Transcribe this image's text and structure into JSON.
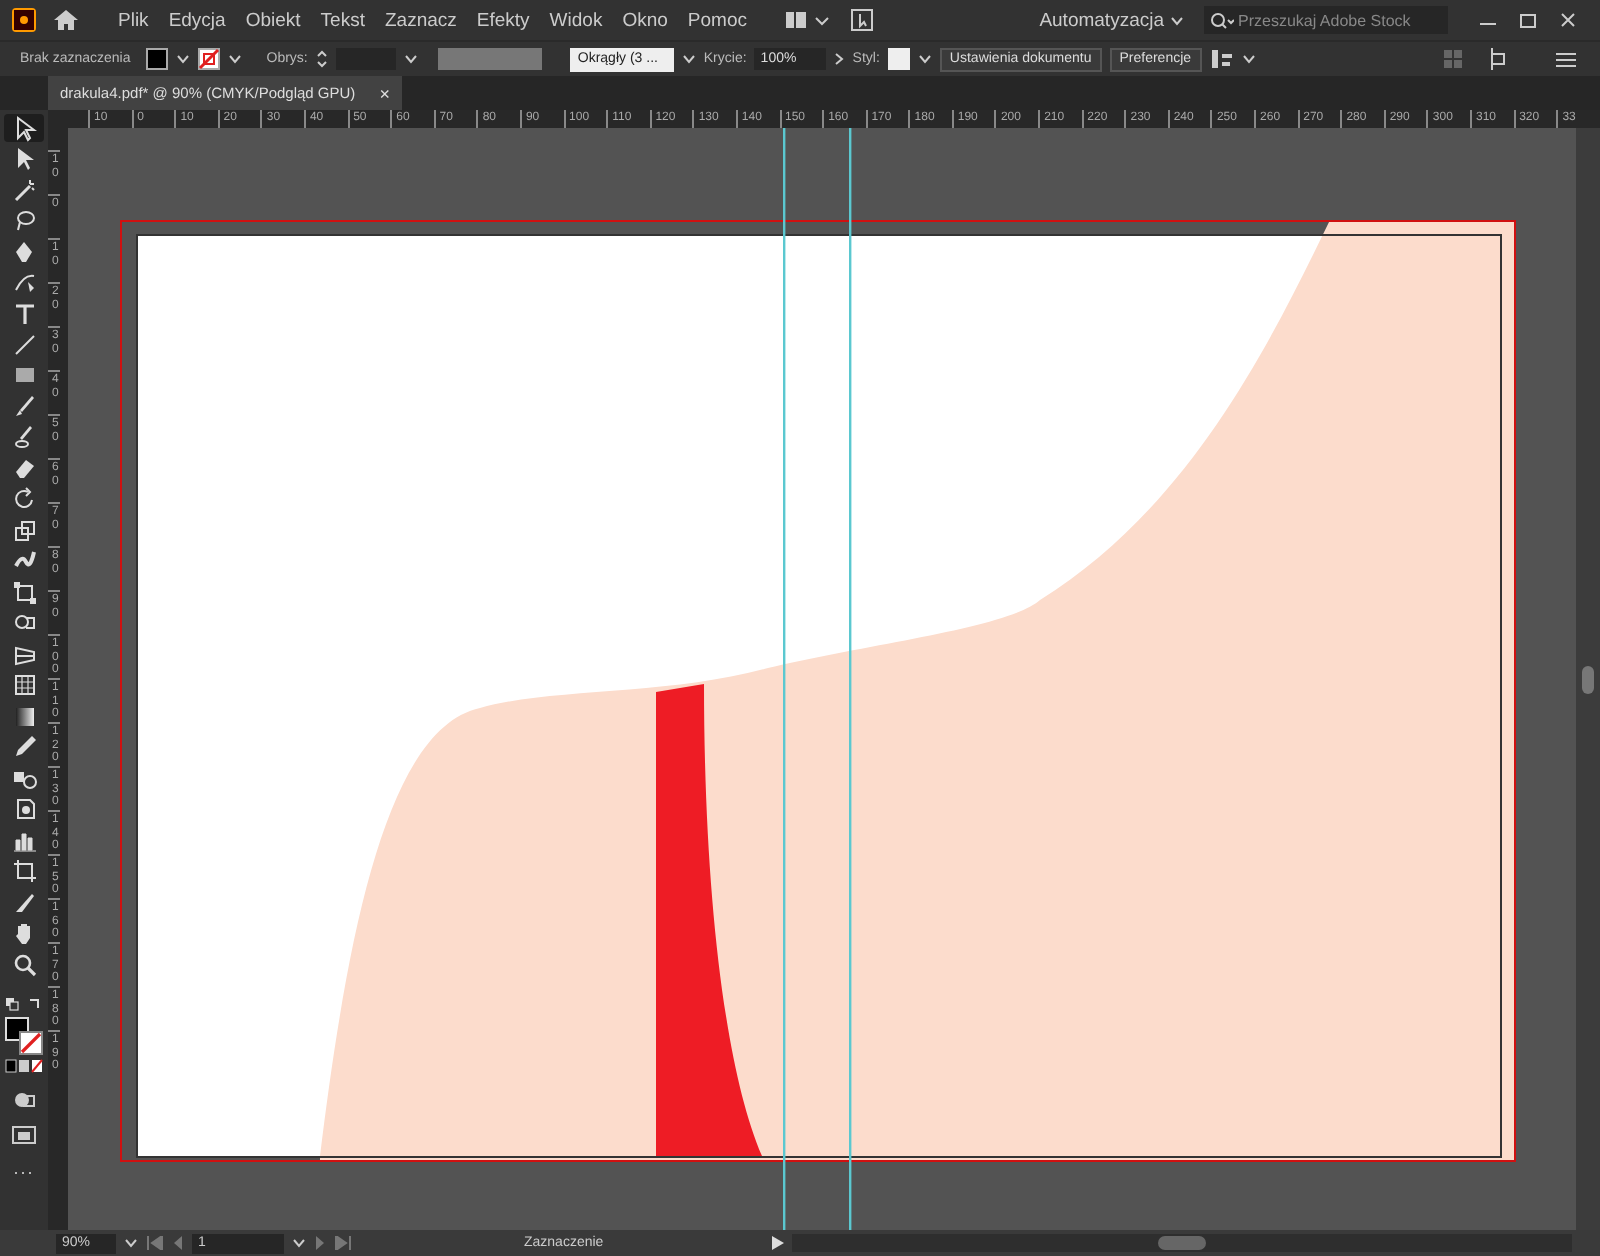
{
  "menu_bar": {
    "items": [
      "Plik",
      "Edycja",
      "Obiekt",
      "Tekst",
      "Zaznacz",
      "Efekty",
      "Widok",
      "Okno",
      "Pomoc"
    ],
    "workspace": "Automatyzacja",
    "search": {
      "placeholder": "Przeszukaj Adobe Stock"
    }
  },
  "control_bar": {
    "selection_label": "Brak zaznaczenia",
    "stroke_label": "Obrys:",
    "brush": "Okrągły (3 ...",
    "opacity_label": "Krycie:",
    "opacity_value": "100%",
    "style_label": "Styl:",
    "buttons": [
      "Ustawienia dokumentu",
      "Preferencje"
    ]
  },
  "document_tab": {
    "title": "drakula4.pdf* @ 90% (CMYK/Podgląd GPU)",
    "close": "×"
  },
  "horizontal_ruler": [
    "10",
    "0",
    "10",
    "20",
    "30",
    "40",
    "50",
    "60",
    "70",
    "80",
    "90",
    "100",
    "110",
    "120",
    "130",
    "140",
    "150",
    "160",
    "170",
    "180",
    "190",
    "200",
    "210",
    "220",
    "230",
    "240",
    "250",
    "260",
    "270",
    "280",
    "290",
    "300",
    "310",
    "320",
    "33"
  ],
  "vertical_ruler": [
    "10",
    "0",
    "10",
    "20",
    "30",
    "40",
    "50",
    "60",
    "70",
    "80",
    "90",
    "100",
    "110",
    "120",
    "130",
    "140",
    "150",
    "160",
    "170",
    "180",
    "190"
  ],
  "toolbar": {
    "tools": [
      {
        "kind": "selection",
        "selected": true
      },
      {
        "kind": "direct",
        "selected": false
      },
      {
        "kind": "wand",
        "selected": false
      },
      {
        "kind": "lasso",
        "selected": false
      },
      {
        "kind": "pen",
        "selected": false
      },
      {
        "kind": "curvature",
        "selected": false
      },
      {
        "kind": "type",
        "selected": false
      },
      {
        "kind": "line",
        "selected": false
      },
      {
        "kind": "rect",
        "selected": false
      },
      {
        "kind": "brush",
        "selected": false
      },
      {
        "kind": "blob",
        "selected": false
      },
      {
        "kind": "eraser",
        "selected": false
      },
      {
        "kind": "rotate",
        "selected": false
      },
      {
        "kind": "scale",
        "selected": false
      },
      {
        "kind": "warp",
        "selected": false
      },
      {
        "kind": "freetransform",
        "selected": false
      },
      {
        "kind": "shapebuilder",
        "selected": false
      },
      {
        "kind": "perspective",
        "selected": false
      },
      {
        "kind": "mesh",
        "selected": false
      },
      {
        "kind": "gradient",
        "selected": false
      },
      {
        "kind": "eyedropper",
        "selected": false
      },
      {
        "kind": "blend",
        "selected": false
      },
      {
        "kind": "symbol",
        "selected": false
      },
      {
        "kind": "graph",
        "selected": false
      },
      {
        "kind": "artboard",
        "selected": false
      },
      {
        "kind": "slice",
        "selected": false
      },
      {
        "kind": "hand",
        "selected": false
      },
      {
        "kind": "zoom",
        "selected": false
      }
    ],
    "more": "..."
  },
  "status_bar": {
    "zoom": "90%",
    "artboard": "1",
    "tool": "Zaznaczenie"
  }
}
